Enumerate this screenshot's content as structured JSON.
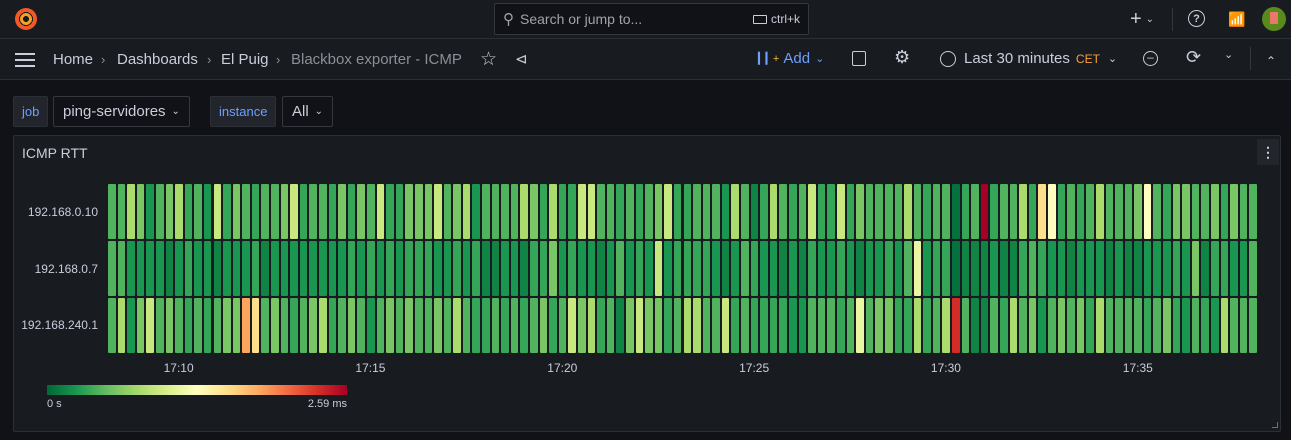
{
  "topbar": {
    "search_placeholder": "Search or jump to...",
    "shortcut": "ctrl+k"
  },
  "breadcrumb": [
    "Home",
    "Dashboards",
    "El Puig",
    "Blackbox exporter - ICMP"
  ],
  "toolbar": {
    "add_label": "Add",
    "time_range": "Last 30 minutes",
    "timezone": "CET"
  },
  "variables": [
    {
      "label": "job",
      "value": "ping-servidores"
    },
    {
      "label": "instance",
      "value": "All"
    }
  ],
  "panel": {
    "title": "ICMP RTT"
  },
  "chart_data": {
    "type": "heatmap",
    "title": "ICMP RTT",
    "x_ticks": [
      "17:10",
      "17:15",
      "17:20",
      "17:25",
      "17:30",
      "17:35"
    ],
    "x_range": [
      "17:08",
      "17:38"
    ],
    "step_seconds": 15,
    "unit": "ms",
    "scale": {
      "min_label": "0 s",
      "max_label": "2.59 ms",
      "min": 0,
      "max": 2.59
    },
    "colors": [
      "#006837",
      "#1a9850",
      "#66bd63",
      "#a6d96a",
      "#d9ef8b",
      "#ffffbf",
      "#fee08b",
      "#fdae61",
      "#f46d43",
      "#d73027",
      "#a50026"
    ],
    "series": [
      {
        "name": "192.168.0.10",
        "values": [
          0.45,
          0.45,
          0.8,
          0.6,
          0.25,
          0.45,
          0.6,
          0.8,
          0.35,
          0.45,
          0.25,
          0.95,
          0.35,
          0.6,
          0.45,
          0.35,
          0.45,
          0.45,
          0.6,
          0.95,
          0.35,
          0.45,
          0.45,
          0.35,
          0.6,
          0.35,
          0.6,
          0.45,
          0.95,
          0.35,
          0.35,
          0.6,
          0.6,
          0.6,
          0.95,
          0.45,
          0.6,
          0.8,
          0.25,
          0.45,
          0.45,
          0.45,
          0.45,
          0.8,
          0.6,
          0.35,
          0.8,
          0.35,
          0.35,
          0.95,
          0.95,
          0.45,
          0.45,
          0.35,
          0.45,
          0.35,
          0.45,
          0.6,
          0.95,
          0.35,
          0.35,
          0.45,
          0.45,
          0.45,
          0.25,
          0.8,
          0.45,
          0.15,
          0.35,
          0.8,
          0.45,
          0.35,
          0.45,
          0.95,
          0.35,
          0.35,
          0.95,
          0.35,
          0.6,
          0.45,
          0.45,
          0.45,
          0.45,
          0.8,
          0.45,
          0.35,
          0.45,
          0.45,
          0.05,
          0.35,
          0.45,
          2.59,
          0.35,
          0.45,
          0.45,
          0.8,
          0.35,
          1.55,
          1.3,
          0.35,
          0.45,
          0.35,
          0.45,
          0.8,
          0.45,
          0.45,
          0.45,
          0.6,
          1.3,
          0.45,
          0.35,
          0.6,
          0.6,
          0.45,
          0.45,
          0.6,
          0.35,
          0.6,
          0.45,
          0.45
        ]
      },
      {
        "name": "192.168.0.7",
        "values": [
          0.45,
          0.45,
          0.25,
          0.25,
          0.25,
          0.25,
          0.15,
          0.25,
          0.35,
          0.25,
          0.25,
          0.15,
          0.25,
          0.25,
          0.25,
          0.35,
          0.15,
          0.25,
          0.25,
          0.25,
          0.25,
          0.25,
          0.25,
          0.25,
          0.25,
          0.35,
          0.25,
          0.35,
          0.25,
          0.35,
          0.25,
          0.35,
          0.35,
          0.35,
          0.25,
          0.25,
          0.35,
          0.25,
          0.35,
          0.15,
          0.15,
          0.25,
          0.25,
          0.15,
          0.35,
          0.35,
          0.6,
          0.25,
          0.35,
          0.25,
          0.25,
          0.15,
          0.25,
          0.45,
          0.25,
          0.35,
          0.25,
          0.95,
          0.25,
          0.35,
          0.35,
          0.35,
          0.35,
          0.25,
          0.15,
          0.25,
          0.45,
          0.35,
          0.25,
          0.25,
          0.15,
          0.25,
          0.15,
          0.35,
          0.25,
          0.25,
          0.35,
          0.25,
          0.15,
          0.25,
          0.25,
          0.35,
          0.25,
          0.45,
          1.15,
          0.25,
          0.35,
          0.35,
          0.05,
          0.15,
          0.15,
          0.15,
          0.25,
          0.15,
          0.15,
          0.35,
          0.45,
          0.35,
          0.25,
          0.25,
          0.15,
          0.25,
          0.25,
          0.25,
          0.15,
          0.25,
          0.15,
          0.15,
          0.25,
          0.25,
          0.25,
          0.35,
          0.25,
          0.6,
          0.15,
          0.35,
          0.35,
          0.25,
          0.25,
          0.45
        ]
      },
      {
        "name": "192.168.240.1",
        "values": [
          0.45,
          0.8,
          0.25,
          0.6,
          0.95,
          0.45,
          0.6,
          0.45,
          0.35,
          0.45,
          0.35,
          0.45,
          0.6,
          0.6,
          1.85,
          1.55,
          0.45,
          0.6,
          0.45,
          0.35,
          0.45,
          0.6,
          0.8,
          0.35,
          0.45,
          0.6,
          0.45,
          0.25,
          0.45,
          0.6,
          0.45,
          0.6,
          0.45,
          0.45,
          0.6,
          0.45,
          0.8,
          0.45,
          0.35,
          0.35,
          0.45,
          0.35,
          0.45,
          0.35,
          0.45,
          0.6,
          0.35,
          0.45,
          0.95,
          0.6,
          0.8,
          0.35,
          0.45,
          0.15,
          0.6,
          0.95,
          0.6,
          0.6,
          0.35,
          0.45,
          0.8,
          0.8,
          0.45,
          0.45,
          0.95,
          0.35,
          0.45,
          0.35,
          0.35,
          0.35,
          0.35,
          0.25,
          0.25,
          0.45,
          0.45,
          0.45,
          0.35,
          0.45,
          1.15,
          0.45,
          0.6,
          0.6,
          0.35,
          0.35,
          0.8,
          0.35,
          0.45,
          0.8,
          2.35,
          0.45,
          0.15,
          0.15,
          0.45,
          0.35,
          0.8,
          0.45,
          0.6,
          0.25,
          0.45,
          0.6,
          0.45,
          0.6,
          0.35,
          0.8,
          0.45,
          0.45,
          0.45,
          0.45,
          0.35,
          0.45,
          0.6,
          0.35,
          0.25,
          0.45,
          0.35,
          0.25,
          0.8,
          0.45,
          0.45,
          0.45
        ]
      }
    ]
  }
}
